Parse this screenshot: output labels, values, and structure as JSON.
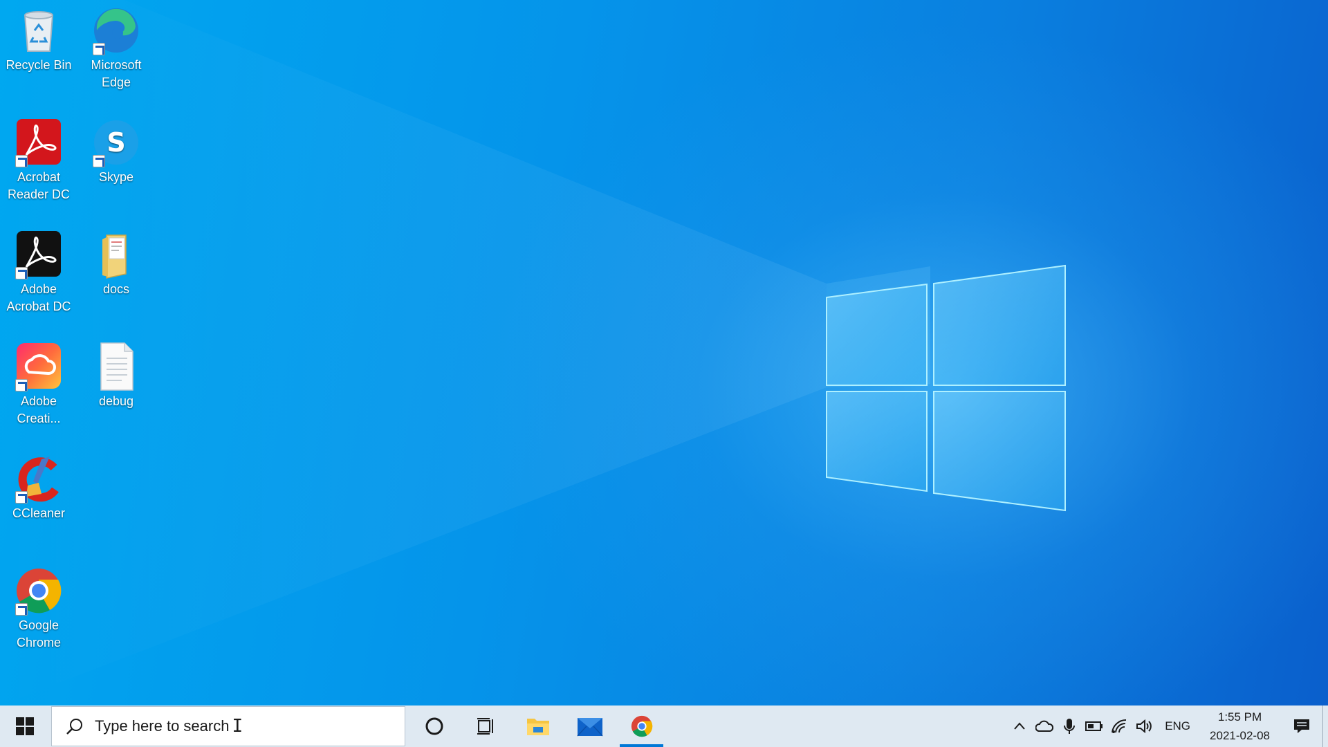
{
  "desktop": {
    "icons": [
      {
        "label": "Recycle Bin",
        "icon": "recycle-bin-icon"
      },
      {
        "label": "Microsoft Edge",
        "icon": "edge-icon"
      },
      {
        "label": "Acrobat Reader DC",
        "icon": "acrobat-reader-icon"
      },
      {
        "label": "Skype",
        "icon": "skype-icon"
      },
      {
        "label": "Adobe Acrobat DC",
        "icon": "adobe-acrobat-icon"
      },
      {
        "label": "docs",
        "icon": "folder-icon"
      },
      {
        "label": "Adobe Creati...",
        "icon": "creative-cloud-icon"
      },
      {
        "label": "debug",
        "icon": "text-file-icon"
      },
      {
        "label": "CCleaner",
        "icon": "ccleaner-icon"
      },
      {
        "label": "Google Chrome",
        "icon": "chrome-icon"
      }
    ]
  },
  "taskbar": {
    "start_icon": "windows-logo-icon",
    "search_placeholder": "Type here to search",
    "apps": [
      {
        "name": "Cortana",
        "icon": "cortana-icon"
      },
      {
        "name": "Task View",
        "icon": "task-view-icon"
      },
      {
        "name": "File Explorer",
        "icon": "file-explorer-icon"
      },
      {
        "name": "Mail",
        "icon": "mail-icon"
      },
      {
        "name": "Google Chrome",
        "icon": "chrome-icon",
        "active": true
      }
    ],
    "tray": {
      "language": "ENG",
      "time": "1:55 PM",
      "date": "2021-02-08",
      "icons": [
        "chevron-up-icon",
        "onedrive-icon",
        "microphone-icon",
        "battery-icon",
        "wifi-icon",
        "volume-icon"
      ]
    }
  },
  "colors": {
    "accent": "#0078d7",
    "taskbar_bg": "#dfe9f2"
  }
}
